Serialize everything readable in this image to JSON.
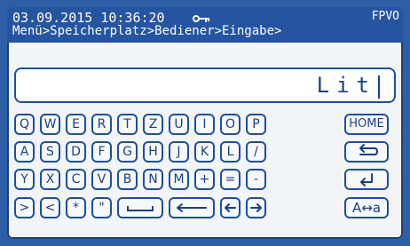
{
  "status_bar": {
    "datetime": "03.09.2015 10:36:20",
    "key_icon": "key-icon",
    "device_id": "FPVO"
  },
  "breadcrumb": "Menü>Speicherplatz>Bediener>Eingabe>",
  "input": {
    "value": "Lit"
  },
  "keyboard": {
    "row1": [
      "Q",
      "W",
      "E",
      "R",
      "T",
      "Z",
      "U",
      "I",
      "O",
      "P"
    ],
    "row2": [
      "A",
      "S",
      "D",
      "F",
      "G",
      "H",
      "J",
      "K",
      "L",
      "/"
    ],
    "row3": [
      "Y",
      "X",
      "C",
      "V",
      "B",
      "N",
      "M",
      "+",
      "=",
      "-"
    ],
    "row4": [
      ">",
      "<",
      "*",
      "\""
    ],
    "space_icon": "space-icon",
    "backspace_icon": "backspace-arrow-icon",
    "cursor_left_icon": "arrow-left-icon",
    "cursor_right_icon": "arrow-right-icon"
  },
  "side_keys": {
    "home": "HOME",
    "back_icon": "return-arrow-icon",
    "enter_icon": "enter-icon",
    "case_toggle": "A↔a"
  },
  "colors": {
    "frame": "#2d5fa6",
    "header": "#2554a0",
    "key_outline": "#1e4f9a"
  }
}
